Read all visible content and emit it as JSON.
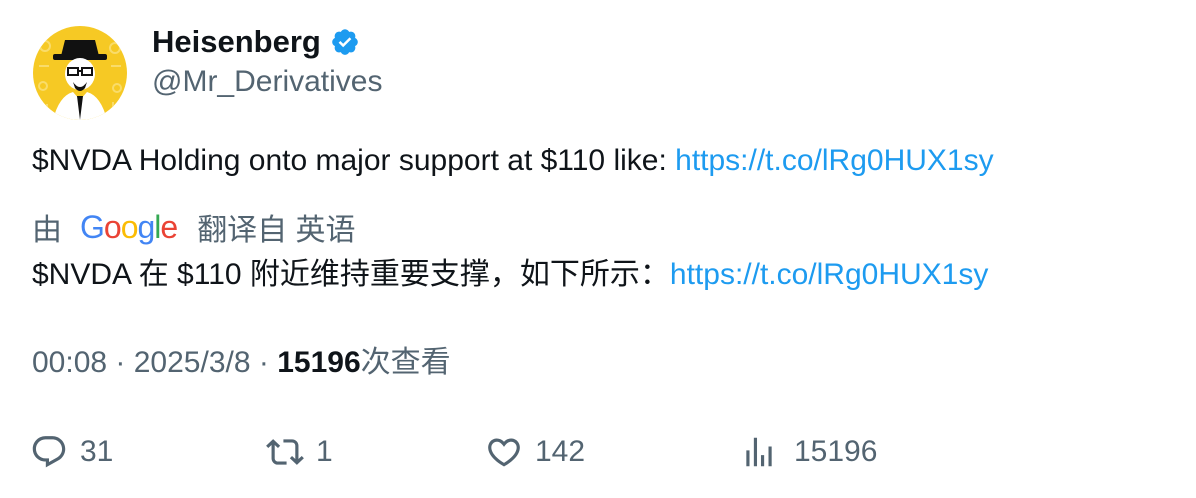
{
  "author": {
    "display_name": "Heisenberg",
    "handle": "@Mr_Derivatives",
    "verified": true
  },
  "tweet": {
    "text": "$NVDA Holding onto major support at $110 like: ",
    "link": "https://t.co/lRg0HUX1sy"
  },
  "translation": {
    "prefix": "由",
    "provider_logo_letters": [
      "G",
      "o",
      "o",
      "g",
      "l",
      "e"
    ],
    "suffix": "翻译自 英语",
    "text": "$NVDA 在 $110 附近维持重要支撑，如下所示：",
    "link": "https://t.co/lRg0HUX1sy"
  },
  "meta": {
    "time": "00:08",
    "separator": " · ",
    "date": "2025/3/8",
    "views_count": "15196",
    "views_label": "次查看"
  },
  "actions": {
    "reply_count": "31",
    "retweet_count": "1",
    "like_count": "142",
    "views_count": "15196"
  },
  "colors": {
    "link": "#1d9bf0",
    "muted": "#536471",
    "text": "#0f1419",
    "verified": "#1d9bf0",
    "avatar_bg": "#f6c924"
  },
  "icons": {
    "verified": "verified-badge-icon",
    "reply": "speech-bubble-icon",
    "retweet": "retweet-arrows-icon",
    "like": "heart-icon",
    "views": "bar-chart-icon"
  }
}
